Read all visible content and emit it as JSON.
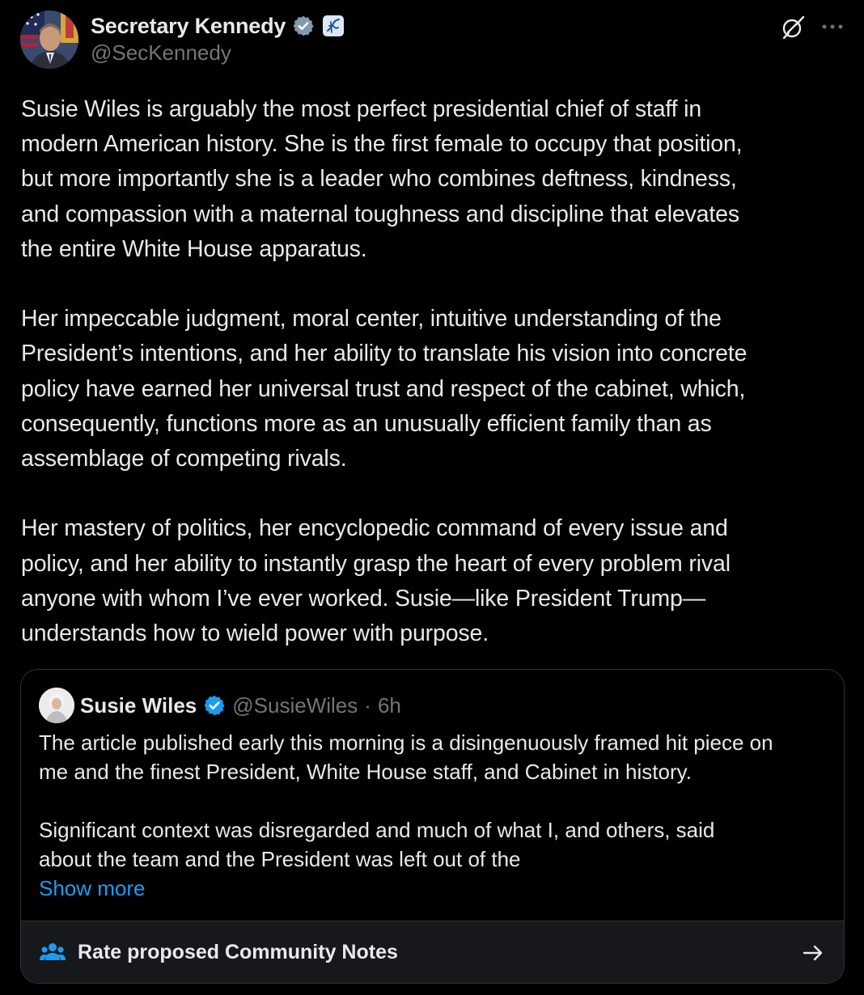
{
  "author": {
    "display_name": "Secretary Kennedy",
    "handle": "@SecKennedy",
    "verified_badge": "verified-badge-icon",
    "affiliation_badge": "hhs-affiliation-icon"
  },
  "tweet": {
    "paragraphs": [
      "Susie Wiles is arguably the most perfect presidential chief of staff in\nmodern American history. She is the first female to occupy that position,\nbut more importantly she is a leader who combines deftness, kindness,\nand compassion with a maternal toughness and discipline that elevates\nthe entire White House apparatus.",
      "Her impeccable judgment, moral center, intuitive understanding of the\nPresident’s intentions, and her ability to translate his vision into concrete\npolicy have earned her universal trust and respect of the cabinet, which,\nconsequently, functions more as an unusually efficient family than as\nassemblage of competing rivals.",
      "Her mastery of politics, her encyclopedic command of every issue and\npolicy, and her ability to instantly grasp the heart of every problem rival\nanyone with whom I’ve ever worked. Susie—like President Trump—\nunderstands how to wield power with purpose."
    ]
  },
  "quote": {
    "display_name": "Susie Wiles",
    "handle": "@SusieWiles",
    "separator": "·",
    "time": "6h",
    "paragraphs": [
      "The article published early this morning is a disingenuously framed hit piece on\nme and the finest President, White House staff, and Cabinet in history.",
      "Significant context was disregarded and much of what I, and others, said\nabout the team and the President was left out of the"
    ],
    "show_more_label": "Show more"
  },
  "community_notes": {
    "label": "Rate proposed Community Notes"
  },
  "colors": {
    "background": "#000000",
    "text_primary": "#e7e9ea",
    "text_secondary": "#71767b",
    "accent_blue": "#1d9bf0",
    "border": "#2f3336"
  }
}
